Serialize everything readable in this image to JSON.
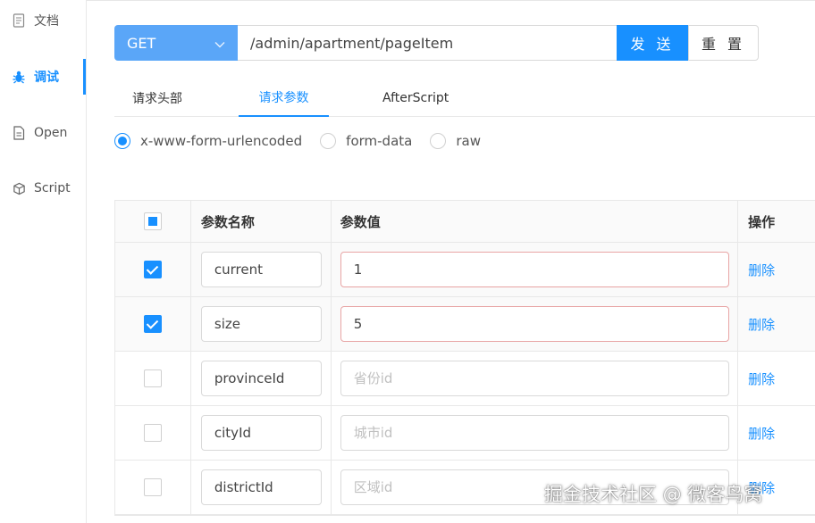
{
  "sidebar": {
    "items": [
      {
        "label": "文档",
        "icon": "document-icon",
        "active": false
      },
      {
        "label": "调试",
        "icon": "bug-icon",
        "active": true
      },
      {
        "label": "Open",
        "icon": "file-icon",
        "active": false
      },
      {
        "label": "Script",
        "icon": "cube-icon",
        "active": false
      }
    ]
  },
  "request": {
    "method": "GET",
    "url": "/admin/apartment/pageItem",
    "send_label": "发 送",
    "reset_label": "重 置"
  },
  "tabs": [
    {
      "label": "请求头部",
      "active": false
    },
    {
      "label": "请求参数",
      "active": true
    },
    {
      "label": "AfterScript",
      "active": false
    }
  ],
  "body_types": [
    {
      "label": "x-www-form-urlencoded",
      "checked": true
    },
    {
      "label": "form-data",
      "checked": false
    },
    {
      "label": "raw",
      "checked": false
    }
  ],
  "table": {
    "headers": {
      "name": "参数名称",
      "value": "参数值",
      "action": "操作"
    },
    "rows": [
      {
        "checked": true,
        "name": "current",
        "value": "1",
        "placeholder": "",
        "action": "删除"
      },
      {
        "checked": true,
        "name": "size",
        "value": "5",
        "placeholder": "",
        "action": "删除"
      },
      {
        "checked": false,
        "name": "provinceId",
        "value": "",
        "placeholder": "省份id",
        "action": "删除"
      },
      {
        "checked": false,
        "name": "cityId",
        "value": "",
        "placeholder": "城市id",
        "action": "删除"
      },
      {
        "checked": false,
        "name": "districtId",
        "value": "",
        "placeholder": "区域id",
        "action": "删除"
      }
    ]
  },
  "watermark": "掘金技术社区 @ 微客鸟窝",
  "colors": {
    "accent": "#1890ff",
    "method_bg": "#5aa6f8",
    "error_border": "#e8a4a4"
  }
}
